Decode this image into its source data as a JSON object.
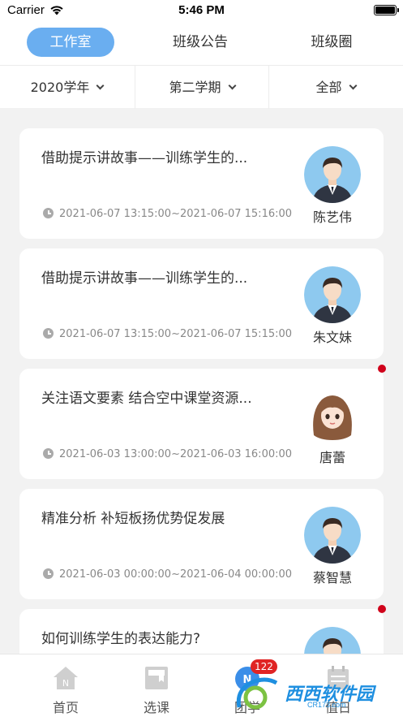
{
  "status_bar": {
    "carrier": "Carrier",
    "time": "5:46 PM"
  },
  "top_tabs": [
    {
      "label": "工作室",
      "active": true
    },
    {
      "label": "班级公告",
      "active": false
    },
    {
      "label": "班级圈",
      "active": false
    }
  ],
  "filters": [
    {
      "label": "2020学年"
    },
    {
      "label": "第二学期"
    },
    {
      "label": "全部"
    }
  ],
  "cards": [
    {
      "title": "借助提示讲故事——训练学生的...",
      "time": "2021-06-07 13:15:00~2021-06-07 15:16:00",
      "name": "陈艺伟",
      "avatar": "male-avatar-icon",
      "unread": false
    },
    {
      "title": "借助提示讲故事——训练学生的...",
      "time": "2021-06-07 13:15:00~2021-06-07 15:15:00",
      "name": "朱文妹",
      "avatar": "male-avatar-icon",
      "unread": false
    },
    {
      "title": "关注语文要素 结合空中课堂资源...",
      "time": "2021-06-03 13:00:00~2021-06-03 16:00:00",
      "name": "唐蕾",
      "avatar": "female-avatar-icon",
      "unread": true
    },
    {
      "title": "精准分析  补短板扬优势促发展",
      "time": "2021-06-03 00:00:00~2021-06-04 00:00:00",
      "name": "蔡智慧",
      "avatar": "male-avatar-icon",
      "unread": false
    },
    {
      "title": "如何训练学生的表达能力?",
      "time": "",
      "name": "",
      "avatar": "male-avatar-icon",
      "unread": true
    }
  ],
  "bottom_nav": [
    {
      "label": "首页",
      "icon": "home-icon"
    },
    {
      "label": "选课",
      "icon": "course-select-icon"
    },
    {
      "label": "团学",
      "icon": "team-study-icon",
      "badge": "122"
    },
    {
      "label": "值日",
      "icon": "duty-icon"
    }
  ],
  "watermark": {
    "text": "西西软件园",
    "sub": "CR173.com"
  },
  "colors": {
    "accent": "#6aaef0",
    "unread_dot": "#d0021b",
    "badge": "#e02424"
  }
}
